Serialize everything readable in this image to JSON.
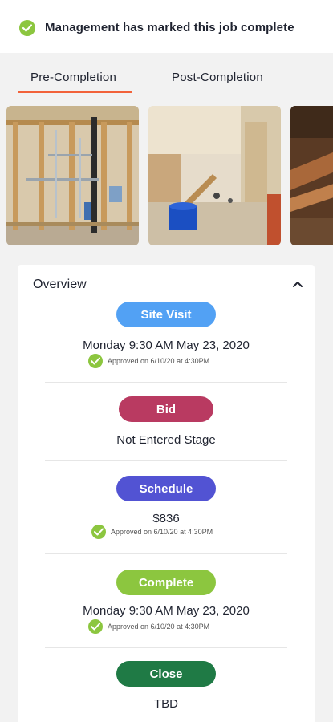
{
  "banner": {
    "text": "Management has marked this job complete",
    "icon": "check-circle-icon",
    "icon_color": "#8cc63f"
  },
  "tabs": [
    {
      "label": "Pre-Completion",
      "selected": true
    },
    {
      "label": "Post-Completion",
      "selected": false
    }
  ],
  "tab_accent_color": "#f2623a",
  "photos": [
    {
      "subject": "stud wall with exposed plumbing pipes"
    },
    {
      "subject": "gutted bathroom with blue bucket"
    },
    {
      "subject": "rusted pipes in dirt"
    }
  ],
  "overview": {
    "title": "Overview",
    "collapse_icon": "chevron-up-icon",
    "stages": [
      {
        "label": "Site Visit",
        "color": "#52a1f4",
        "value": "Monday 9:30 AM May 23, 2020",
        "approval": "Approved on 6/10/20 at 4:30PM"
      },
      {
        "label": "Bid",
        "color": "#b93a61",
        "value": "Not Entered Stage"
      },
      {
        "label": "Schedule",
        "color": "#5253d3",
        "value": "$836",
        "approval": "Approved on 6/10/20 at 4:30PM"
      },
      {
        "label": "Complete",
        "color": "#8cc63f",
        "value": "Monday 9:30 AM May 23, 2020",
        "approval": "Approved on 6/10/20 at 4:30PM"
      },
      {
        "label": "Close",
        "color": "#1f7a45",
        "value": "TBD"
      }
    ]
  }
}
